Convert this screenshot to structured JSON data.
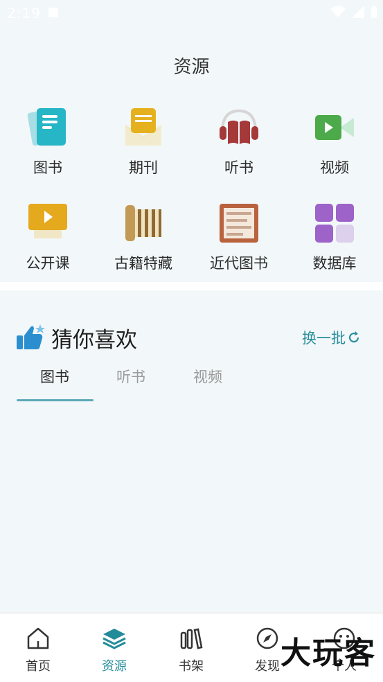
{
  "status_bar": {
    "time": "2:19"
  },
  "page": {
    "title": "资源"
  },
  "resources": [
    {
      "label": "图书",
      "icon": "book-icon"
    },
    {
      "label": "期刊",
      "icon": "journal-icon"
    },
    {
      "label": "听书",
      "icon": "headphones-icon"
    },
    {
      "label": "视频",
      "icon": "video-camera-icon"
    },
    {
      "label": "公开课",
      "icon": "open-course-icon"
    },
    {
      "label": "古籍特藏",
      "icon": "ancient-books-icon"
    },
    {
      "label": "近代图书",
      "icon": "modern-books-icon"
    },
    {
      "label": "数据库",
      "icon": "database-grid-icon"
    }
  ],
  "recommend": {
    "title": "猜你喜欢",
    "refresh_label": "换一批",
    "tabs": [
      "图书",
      "听书",
      "视频"
    ],
    "active_tab": 0
  },
  "bottom_nav": [
    {
      "label": "首页",
      "icon": "home-icon"
    },
    {
      "label": "资源",
      "icon": "layers-icon",
      "active": true
    },
    {
      "label": "书架",
      "icon": "bookshelf-icon"
    },
    {
      "label": "发现",
      "icon": "compass-icon"
    },
    {
      "label": "个人",
      "icon": "smiley-icon"
    }
  ],
  "watermark": {
    "text": "大玩客"
  },
  "colors": {
    "accent": "#238c99",
    "background": "#f2f7fa"
  }
}
